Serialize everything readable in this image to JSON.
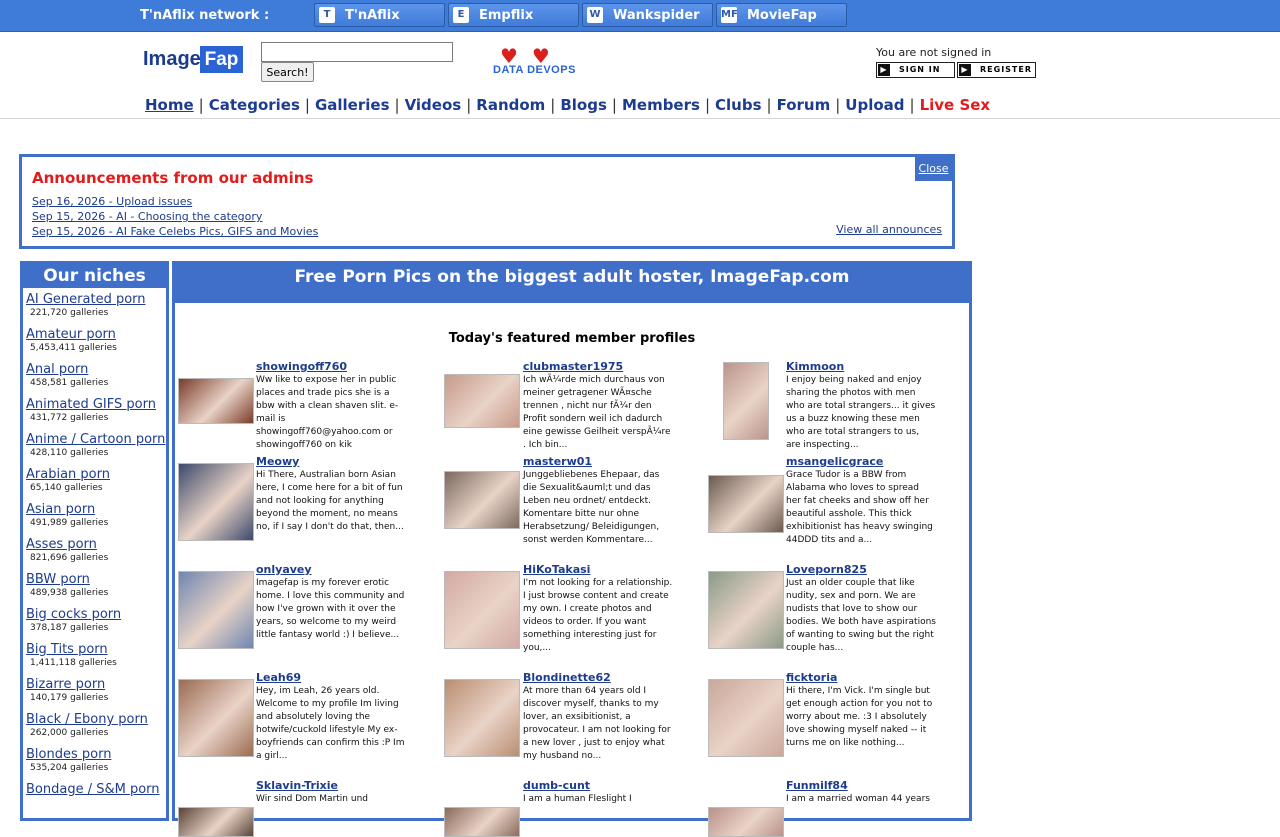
{
  "network": {
    "label": "T'nAflix network :",
    "sites": [
      {
        "name": "T'nAflix",
        "icon": "tnaflix-icon",
        "glyph": "T"
      },
      {
        "name": "Empflix",
        "icon": "empflix-icon",
        "glyph": "E"
      },
      {
        "name": "Wankspider",
        "icon": "wankspider-icon",
        "glyph": "W"
      },
      {
        "name": "MovieFap",
        "icon": "moviefap-icon",
        "glyph": "MF"
      }
    ]
  },
  "header": {
    "logo_word1": "Image",
    "logo_word2": "Fap",
    "search_value": "",
    "search_button": "Search!",
    "devops_hearts": "♥♥",
    "devops_text": "DATA DEVOPS",
    "signin_status": "You are not signed in",
    "signin_label": "SIGN IN",
    "register_label": "REGISTER"
  },
  "nav": [
    {
      "label": "Home",
      "cls": "home"
    },
    {
      "label": "Categories",
      "cls": ""
    },
    {
      "label": "Galleries",
      "cls": ""
    },
    {
      "label": "Videos",
      "cls": ""
    },
    {
      "label": "Random",
      "cls": ""
    },
    {
      "label": "Blogs",
      "cls": ""
    },
    {
      "label": "Members",
      "cls": ""
    },
    {
      "label": "Clubs",
      "cls": ""
    },
    {
      "label": "Forum",
      "cls": ""
    },
    {
      "label": "Upload",
      "cls": ""
    },
    {
      "label": "Live Sex",
      "cls": "live"
    }
  ],
  "announcements": {
    "title": "Announcements from our admins",
    "close": "Close",
    "items": [
      "Sep 16, 2026 - Upload issues",
      "Sep 15, 2026 - AI - Choosing the category",
      "Sep 15, 2026 - AI Fake Celebs Pics, GIFS and Movies"
    ],
    "view_all": "View all announces"
  },
  "niches": {
    "title": "Our niches",
    "items": [
      {
        "name": "AI Generated porn",
        "count": "221,720 galleries"
      },
      {
        "name": "Amateur porn",
        "count": "5,453,411 galleries"
      },
      {
        "name": "Anal porn",
        "count": "458,581 galleries"
      },
      {
        "name": "Animated GIFS porn",
        "count": "431,772 galleries"
      },
      {
        "name": "Anime / Cartoon porn",
        "count": "428,110 galleries"
      },
      {
        "name": "Arabian porn",
        "count": "65,140 galleries"
      },
      {
        "name": "Asian porn",
        "count": "491,989 galleries"
      },
      {
        "name": "Asses porn",
        "count": "821,696 galleries"
      },
      {
        "name": "BBW porn",
        "count": "489,938 galleries"
      },
      {
        "name": "Big cocks porn",
        "count": "378,187 galleries"
      },
      {
        "name": "Big Tits porn",
        "count": "1,411,118 galleries"
      },
      {
        "name": "Bizarre porn",
        "count": "140,179 galleries"
      },
      {
        "name": "Black / Ebony porn",
        "count": "262,000 galleries"
      },
      {
        "name": "Blondes porn",
        "count": "535,204 galleries"
      },
      {
        "name": "Bondage / S&M porn",
        "count": ""
      }
    ]
  },
  "main": {
    "banner": "Free Porn Pics on the biggest adult hoster, ImageFap.com",
    "featured_title": "Today's featured member profiles",
    "profiles": [
      {
        "name": "showingoff760",
        "desc": "Ww like to expose her in public places and trade pics she is a bbw with a clean shaven slit. e-mail is showingoff760@yahoo.com or showingoff760 on kik",
        "color": "#7a3b2a"
      },
      {
        "name": "clubmaster1975",
        "desc": "Ich wÃ¼rde mich durchaus von meiner getragener WÃ¤sche trennen , nicht nur fÃ¼r den Profit sondern weil ich dadurch eine gewisse Geilheit verspÃ¼re . Ich bin...",
        "color": "#c79a8a"
      },
      {
        "name": "Kimmoon",
        "desc": "I enjoy being naked and enjoy sharing the photos with men who are total strangers... it gives us a buzz knowing these men who are total strangers to us, are inspecting...",
        "color": "#b9958c"
      },
      {
        "name": "Meowy",
        "desc": "Hi There, Australian born Asian here, I come here for a bit of fun and not looking for anything beyond the moment, no means no, if I say I don't do that, then...",
        "color": "#3c4a6b"
      },
      {
        "name": "masterw01",
        "desc": "Junggebliebenes Ehepaar, das die Sexualit&auml;t und das Leben neu ordnet/ entdeckt. Komentare bitte nur ohne Herabsetzung/ Beleidigungen, sonst werden Kommentare...",
        "color": "#7c6a5f"
      },
      {
        "name": "msangelicgrace",
        "desc": "Grace Tudor is a BBW from Alabama who loves to spread her fat cheeks and show off her beautiful asshole. This thick exhibitionist has heavy swinging 44DDD tits and a...",
        "color": "#6b5a4e"
      },
      {
        "name": "onlyavey",
        "desc": "Imagefap is my forever erotic home. I love this community and how I've grown with it over the years, so welcome to my weird little fantasy world :) I believe...",
        "color": "#6f86b0"
      },
      {
        "name": "HiKoTakasi",
        "desc": "I'm not looking for a relationship. I just browse content and create my own. I create photos and videos to order. If you want something interesting just for you,...",
        "color": "#d3a9a3"
      },
      {
        "name": "Loveporn825",
        "desc": "Just an older couple that like nudity, sex and porn. We are nudists that love to show our bodies. We both have aspirations of wanting to swing but the right couple has...",
        "color": "#8a9a88"
      },
      {
        "name": "Leah69",
        "desc": "Hey, im Leah, 26 years old. Welcome to my profile Im living and absolutely loving the hotwife/cuckold lifestyle My ex-boyfriends can confirm this :P Im a girl...",
        "color": "#9a6b52"
      },
      {
        "name": "Blondinette62",
        "desc": "At more than 64 years old I discover myself, thanks to my lover, an exsibitionist, a provocateur. I am not looking for a new lover , just to enjoy what my husband no...",
        "color": "#b98e72"
      },
      {
        "name": "ficktoria",
        "desc": "Hi there, I'm Vick. I'm single but get enough action for you not to worry about me. :3 I absolutely love showing myself naked -- it turns me on like nothing...",
        "color": "#caa89a"
      },
      {
        "name": "Sklavin-Trixie",
        "desc": "Wir sind Dom Martin und",
        "color": "#5a4438"
      },
      {
        "name": "dumb-cunt",
        "desc": "I am a human Fleslight I",
        "color": "#8a6b5c"
      },
      {
        "name": "Funmilf84",
        "desc": "I am a married woman 44 years",
        "color": "#b9928a"
      }
    ]
  }
}
